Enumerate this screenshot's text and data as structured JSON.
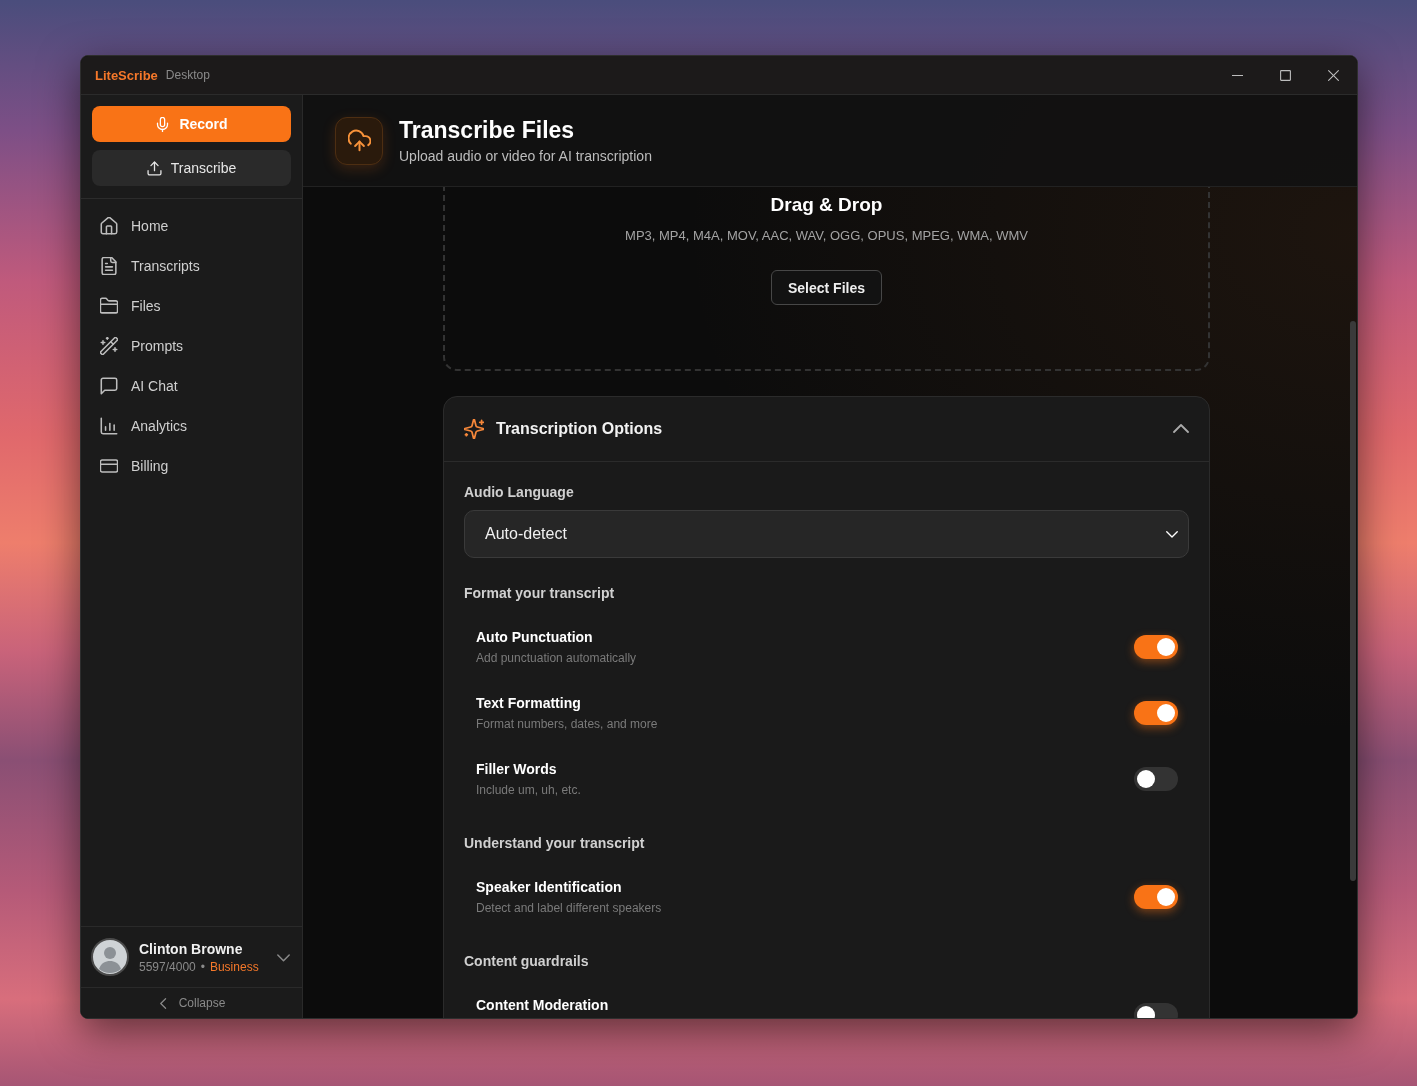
{
  "window": {
    "app_name": "LiteScribe",
    "edition": "Desktop"
  },
  "sidebar": {
    "actions": [
      {
        "label": "Record",
        "kind": "primary"
      },
      {
        "label": "Transcribe",
        "kind": "secondary"
      }
    ],
    "items": [
      {
        "label": "Home",
        "selected": false
      },
      {
        "label": "Transcripts",
        "selected": false
      },
      {
        "label": "Files",
        "selected": false
      },
      {
        "label": "Prompts",
        "selected": false
      },
      {
        "label": "AI Chat",
        "selected": false
      },
      {
        "label": "Analytics",
        "selected": false
      },
      {
        "label": "Billing",
        "selected": false
      }
    ],
    "user": {
      "name": "Clinton Browne",
      "usage": "5597/4000",
      "separator": "•",
      "plan": "Business"
    },
    "collapse": "Collapse"
  },
  "header": {
    "title": "Transcribe Files",
    "subtitle": "Upload audio or video for AI transcription"
  },
  "dropzone": {
    "title": "Drag & Drop",
    "formats": "MP3, MP4, M4A, MOV, AAC, WAV, OGG, OPUS, MPEG, WMA, WMV",
    "button": "Select Files"
  },
  "options": {
    "title": "Transcription Options",
    "expanded": true,
    "language": {
      "label": "Audio Language",
      "value": "Auto-detect"
    },
    "groups": [
      {
        "heading": "Format your transcript",
        "toggles": [
          {
            "title": "Auto Punctuation",
            "description": "Add punctuation automatically",
            "on": true
          },
          {
            "title": "Text Formatting",
            "description": "Format numbers, dates, and more",
            "on": true
          },
          {
            "title": "Filler Words",
            "description": "Include um, uh, etc.",
            "on": false
          }
        ]
      },
      {
        "heading": "Understand your transcript",
        "toggles": [
          {
            "title": "Speaker Identification",
            "description": "Detect and label different speakers",
            "on": true
          }
        ]
      },
      {
        "heading": "Content guardrails",
        "toggles": [
          {
            "title": "Content Moderation",
            "on": false
          }
        ]
      }
    ]
  }
}
